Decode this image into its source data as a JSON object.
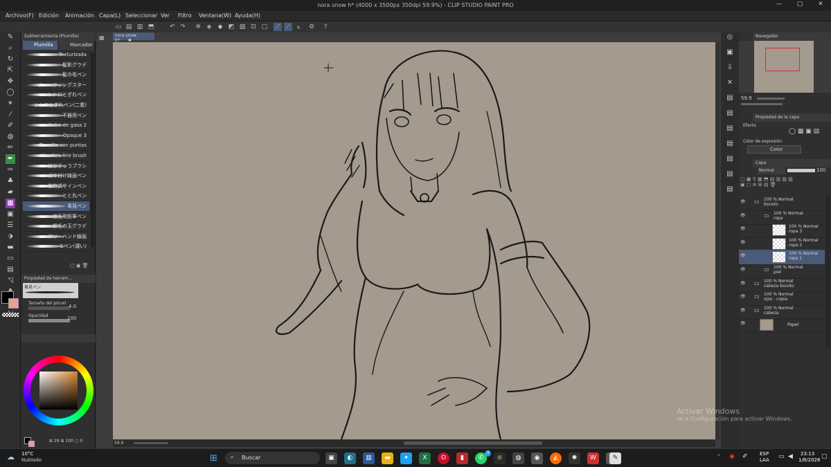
{
  "window": {
    "title": "nora snow h* (4000 x 3500px 350dpi 59.9%)  - CLIP STUDIO PAINT PRO",
    "min": "—",
    "max": "▢",
    "close": "✕"
  },
  "menu": [
    "Archivo(F)",
    "Edición",
    "Animación",
    "Capa(L)",
    "Seleccionar",
    "Ver",
    "Filtro",
    "Ventana(W)",
    "Ayuda(H)"
  ],
  "subtool": {
    "header": "Subherramienta (Plumilla)",
    "tab_pen": "Plumilla",
    "tab_marker": "Marcador",
    "brushes": [
      "Texturizada",
      "髪影グラデ",
      "髪の毛ペン",
      "シューティングスター",
      "レトロとぎれペン",
      "レトロとぎれペン(二重)",
      "不器用ペン",
      "Nube de gasa 2",
      "Opaque 3",
      "Plumilla con puntas",
      "Hirudiz's line brush",
      "にじきゅうブラシ",
      "ガサ付け線画ペン",
      "佐竹式サインペン",
      "とと丸ペン",
      "毒見ペン",
      "線画用鉛筆ペン",
      "綿毛の玉グラデ",
      "フリーハンド線画",
      "Gペン(濃い)"
    ],
    "selected_index": 15
  },
  "tool_property": {
    "header": "Propiedad de herram...",
    "brush_name": "毒見ペン",
    "size_label": "Tamaño del pincel",
    "size_value": "4.0",
    "opacity_label": "Opacidad",
    "opacity_value": "100"
  },
  "colors": {
    "main": "#000000",
    "sub": "#e8a090",
    "canvas_bg": "#a59a8e",
    "accent": "#4a5a78",
    "hue": "#d88830"
  },
  "color_footer": {
    "a": "29",
    "b": "100",
    "c": "0"
  },
  "doc_tab": "nora snow h*",
  "status": {
    "zoom": "59.9"
  },
  "navigator": {
    "header": "Navegador",
    "zoom": "59.9"
  },
  "layer_property": {
    "header": "Propiedad de la capa",
    "effect_label": "Efecto",
    "expression_label": "Color de expresión",
    "expression_value": "Color"
  },
  "layers_panel": {
    "header": "Capa",
    "blend": "Normal",
    "opacity": "100",
    "layers": [
      {
        "mode": "100 % Normal",
        "name": "boceto"
      },
      {
        "mode": "100 % Normal",
        "name": "ropa"
      },
      {
        "mode": "100 % Normal",
        "name": "ropa 3"
      },
      {
        "mode": "100 % Normal",
        "name": "ropa 2"
      },
      {
        "mode": "100 % Normal",
        "name": "ropa 1"
      },
      {
        "mode": "100 % Normal",
        "name": "piel"
      },
      {
        "mode": "100 % Normal",
        "name": "cabeza boceto"
      },
      {
        "mode": "100 % Normal",
        "name": "ojos - copia"
      },
      {
        "mode": "100 % Normal",
        "name": "cabeza"
      },
      {
        "mode": "",
        "name": "Papel"
      }
    ],
    "selected_index": 4
  },
  "watermark": {
    "line1": "Activar Windows",
    "line2": "Ve a Configuración para activar Windows."
  },
  "taskbar": {
    "temp": "10°C",
    "weather": "Nublado",
    "search": "Buscar",
    "lang1": "ESP",
    "lang2": "LAA",
    "time": "23:13",
    "date": "1/8/2026",
    "badge": "3"
  }
}
